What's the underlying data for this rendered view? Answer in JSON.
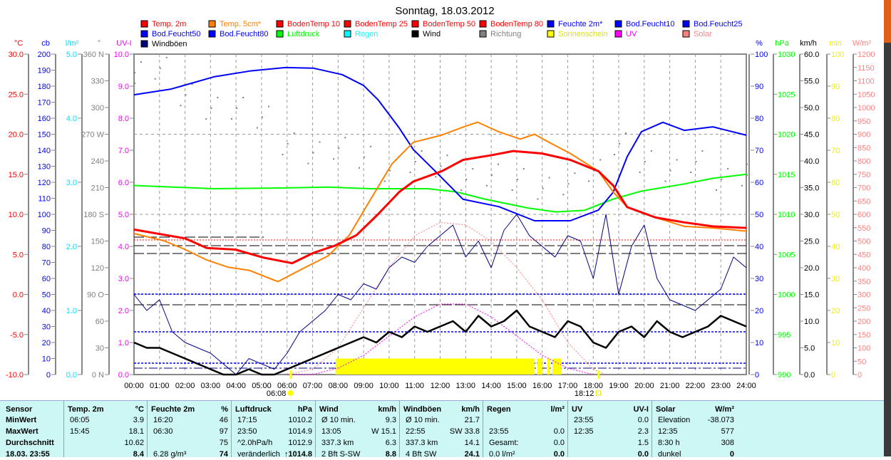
{
  "title": "Sonntag, 18.03.2012",
  "legend": [
    {
      "label": "Temp. 2m",
      "color": "#ff0000"
    },
    {
      "label": "Temp. 5cm*",
      "color": "#ff8000"
    },
    {
      "label": "BodenTemp 10",
      "color": "#ff0000"
    },
    {
      "label": "BodenTemp 25",
      "color": "#ff0000"
    },
    {
      "label": "BodenTemp 50",
      "color": "#ff0000"
    },
    {
      "label": "BodenTemp 80",
      "color": "#ff0000"
    },
    {
      "label": "Feuchte 2m*",
      "color": "#0000ff"
    },
    {
      "label": "Bod.Feucht10",
      "color": "#0000ff"
    },
    {
      "label": "Bod.Feucht25",
      "color": "#0000ff"
    },
    {
      "label": "Bod.Feucht50",
      "color": "#0000ff"
    },
    {
      "label": "Bod.Feucht80",
      "color": "#0000ff"
    },
    {
      "label": "Luftdruck",
      "color": "#00ff00"
    },
    {
      "label": "Regen",
      "color": "#00ffff"
    },
    {
      "label": "Wind",
      "color": "#000000"
    },
    {
      "label": "Richtung",
      "color": "#808080"
    },
    {
      "label": "Sonnenschein",
      "color": "#ffff00"
    },
    {
      "label": "UV",
      "color": "#ff00ff"
    },
    {
      "label": "Solar",
      "color": "#ff8080"
    },
    {
      "label": "Windböen",
      "color": "#000080"
    }
  ],
  "chart_data": {
    "type": "line",
    "title": "Sonntag, 18.03.2012",
    "x_ticks": [
      "00:00",
      "01:00",
      "02:00",
      "03:00",
      "04:00",
      "05:00",
      "06:00",
      "07:00",
      "08:00",
      "09:00",
      "10:00",
      "11:00",
      "12:00",
      "13:00",
      "14:00",
      "15:00",
      "16:00",
      "17:00",
      "18:00",
      "19:00",
      "20:00",
      "21:00",
      "22:00",
      "23:00",
      "24:00"
    ],
    "x_range_hours": [
      0,
      24
    ],
    "sunrise": {
      "label": "06:08",
      "hour": 6.13
    },
    "sunset": {
      "label": "18:12",
      "hour": 18.2
    },
    "grid": true,
    "left_axes": [
      {
        "key": "temp",
        "unit": "°C",
        "color": "#ff0000",
        "range": [
          -10,
          30
        ],
        "labels": [
          "30.0",
          "25.0",
          "20.0",
          "15.0",
          "10.0",
          "5.0",
          "0.0",
          "-5.0",
          "-10.0"
        ]
      },
      {
        "key": "cb",
        "unit": "cb",
        "color": "#0000ff",
        "range": [
          0,
          200
        ],
        "labels": [
          "200",
          "190",
          "180",
          "170",
          "160",
          "150",
          "140",
          "130",
          "120",
          "110",
          "100",
          "90",
          "80",
          "70",
          "60",
          "50",
          "40",
          "30",
          "20",
          "10",
          "0"
        ]
      },
      {
        "key": "rain",
        "unit": "l/m²",
        "color": "#00ffff",
        "range": [
          0,
          5
        ],
        "labels": [
          "5.0",
          "4.0",
          "3.0",
          "2.0",
          "1.0",
          "0.0"
        ]
      },
      {
        "key": "deg",
        "unit": "°",
        "color": "#808080",
        "range": [
          0,
          360
        ],
        "labels": [
          "360 N",
          "330",
          "300",
          "270 W",
          "240",
          "210",
          "180 S",
          "150",
          "120",
          "90 O",
          "60",
          "30",
          "0 N"
        ]
      },
      {
        "key": "uv",
        "unit": "UV-I",
        "color": "#ff00ff",
        "range": [
          0,
          10
        ],
        "labels": [
          "10.0",
          "9.0",
          "8.0",
          "7.0",
          "6.0",
          "5.0",
          "4.0",
          "3.0",
          "2.0",
          "1.0",
          "0.0"
        ]
      }
    ],
    "right_axes": [
      {
        "key": "pct",
        "unit": "%",
        "color": "#0000ff",
        "range": [
          0,
          100
        ],
        "labels": [
          "100",
          "90",
          "80",
          "70",
          "60",
          "50",
          "40",
          "30",
          "20",
          "10",
          "0"
        ]
      },
      {
        "key": "hpa",
        "unit": "hPa",
        "color": "#00ff00",
        "range": [
          990,
          1030
        ],
        "labels": [
          "1030",
          "1025",
          "1020",
          "1015",
          "1010",
          "1005",
          "1000",
          "995",
          "990"
        ]
      },
      {
        "key": "kmh",
        "unit": "km/h",
        "color": "#000000",
        "range": [
          0,
          60
        ],
        "labels": [
          "60.0",
          "55.0",
          "50.0",
          "45.0",
          "40.0",
          "35.0",
          "30.0",
          "25.0",
          "20.0",
          "15.0",
          "10.0",
          "5.0",
          "0.0"
        ]
      },
      {
        "key": "min",
        "unit": "min",
        "color": "#ffff00",
        "range": [
          0,
          100
        ],
        "labels": [
          "100",
          "90",
          "80",
          "70",
          "60",
          "50",
          "40",
          "30",
          "20",
          "10",
          "0"
        ]
      },
      {
        "key": "solar",
        "unit": "W/m²",
        "color": "#ff8080",
        "range": [
          0,
          1200
        ],
        "labels": [
          "1200",
          "1150",
          "1100",
          "1050",
          "1000",
          "950",
          "900",
          "850",
          "800",
          "750",
          "700",
          "650",
          "600",
          "550",
          "500",
          "450",
          "400",
          "350",
          "300",
          "250",
          "200",
          "150",
          "100",
          "50",
          "0"
        ]
      }
    ],
    "series": [
      {
        "name": "Luftdruck",
        "axis": "hpa",
        "color": "#00ff00",
        "width": 2,
        "points": [
          [
            0,
            1013.6
          ],
          [
            3.13,
            1013.2
          ],
          [
            5.92,
            1013.3
          ],
          [
            7.6,
            1013.4
          ],
          [
            9.28,
            1013.2
          ],
          [
            11.51,
            1013.2
          ],
          [
            12.63,
            1012.8
          ],
          [
            13.75,
            1011.9
          ],
          [
            15.42,
            1010.8
          ],
          [
            16.54,
            1010.3
          ],
          [
            17.65,
            1010.5
          ],
          [
            18.78,
            1011.9
          ],
          [
            19.89,
            1012.9
          ],
          [
            21.57,
            1013.8
          ],
          [
            22.69,
            1014.5
          ],
          [
            24,
            1015.0
          ]
        ]
      },
      {
        "name": "Feuchte 2m*",
        "axis": "pct",
        "color": "#0000ff",
        "width": 2,
        "points": [
          [
            0,
            87.3
          ],
          [
            1.45,
            89.1
          ],
          [
            3.13,
            92.9
          ],
          [
            4.53,
            94.7
          ],
          [
            5.92,
            95.8
          ],
          [
            7.04,
            95.6
          ],
          [
            8.16,
            93.6
          ],
          [
            9.0,
            90.2
          ],
          [
            9.56,
            85.8
          ],
          [
            10.4,
            76.9
          ],
          [
            10.95,
            70.2
          ],
          [
            11.79,
            63.6
          ],
          [
            12.9,
            54.7
          ],
          [
            14.3,
            52.4
          ],
          [
            15.7,
            48.0
          ],
          [
            17.1,
            48.0
          ],
          [
            18.2,
            51.3
          ],
          [
            18.78,
            56.9
          ],
          [
            19.33,
            68.0
          ],
          [
            19.89,
            75.8
          ],
          [
            20.73,
            78.7
          ],
          [
            21.57,
            76.2
          ],
          [
            22.69,
            77.3
          ],
          [
            24,
            74.7
          ]
        ]
      },
      {
        "name": "Temp. 5cm*",
        "axis": "temp",
        "color": "#ff8000",
        "width": 2,
        "points": [
          [
            0,
            7.6
          ],
          [
            1.17,
            6.7
          ],
          [
            2.01,
            5.6
          ],
          [
            2.85,
            4.3
          ],
          [
            3.69,
            3.4
          ],
          [
            4.53,
            3.0
          ],
          [
            5.64,
            1.6
          ],
          [
            6.48,
            3.0
          ],
          [
            7.6,
            4.8
          ],
          [
            8.44,
            7.4
          ],
          [
            9.28,
            11.9
          ],
          [
            10.11,
            16.3
          ],
          [
            10.95,
            19.0
          ],
          [
            12.07,
            19.9
          ],
          [
            12.9,
            20.9
          ],
          [
            13.47,
            21.5
          ],
          [
            14.3,
            20.3
          ],
          [
            15.14,
            19.4
          ],
          [
            15.7,
            20.0
          ],
          [
            16.26,
            19.0
          ],
          [
            17.1,
            17.6
          ],
          [
            18.2,
            15.4
          ],
          [
            18.78,
            12.8
          ],
          [
            19.33,
            10.9
          ],
          [
            20.45,
            9.6
          ],
          [
            21.57,
            8.5
          ],
          [
            22.69,
            8.3
          ],
          [
            24,
            7.9
          ]
        ]
      },
      {
        "name": "Temp. 2m",
        "axis": "temp",
        "color": "#ff0000",
        "width": 3,
        "points": [
          [
            0,
            8.1
          ],
          [
            2.0,
            7.0
          ],
          [
            2.85,
            5.8
          ],
          [
            3.97,
            5.6
          ],
          [
            5.08,
            4.6
          ],
          [
            6.2,
            3.9
          ],
          [
            7.04,
            5.2
          ],
          [
            7.88,
            6.1
          ],
          [
            8.72,
            7.4
          ],
          [
            9.56,
            10.0
          ],
          [
            10.4,
            12.8
          ],
          [
            10.95,
            14.1
          ],
          [
            12.07,
            15.4
          ],
          [
            12.9,
            16.8
          ],
          [
            14.03,
            17.4
          ],
          [
            14.86,
            17.9
          ],
          [
            15.98,
            17.6
          ],
          [
            17.1,
            16.8
          ],
          [
            18.2,
            15.4
          ],
          [
            18.78,
            13.6
          ],
          [
            19.33,
            10.9
          ],
          [
            20.45,
            9.6
          ],
          [
            21.57,
            9.0
          ],
          [
            22.69,
            8.5
          ],
          [
            24,
            8.3
          ]
        ]
      },
      {
        "name": "Solar",
        "axis": "solar",
        "color": "#ff8080",
        "width": 1,
        "dash": "2,2",
        "points": [
          [
            6,
            0
          ],
          [
            7,
            20
          ],
          [
            8,
            100
          ],
          [
            9,
            250
          ],
          [
            10,
            400
          ],
          [
            11,
            520
          ],
          [
            12,
            570
          ],
          [
            13,
            560
          ],
          [
            14,
            500
          ],
          [
            15,
            400
          ],
          [
            16,
            280
          ],
          [
            17,
            120
          ],
          [
            18,
            20
          ],
          [
            18.5,
            0
          ]
        ]
      },
      {
        "name": "UV",
        "axis": "uv",
        "color": "#ff00ff",
        "width": 1,
        "dash": "2,2",
        "points": [
          [
            6,
            0
          ],
          [
            7,
            0
          ],
          [
            8,
            0.2
          ],
          [
            9,
            0.6
          ],
          [
            10,
            1.2
          ],
          [
            11,
            1.8
          ],
          [
            12,
            2.2
          ],
          [
            13,
            2.2
          ],
          [
            14,
            1.8
          ],
          [
            15,
            1.2
          ],
          [
            16,
            0.6
          ],
          [
            17,
            0.2
          ],
          [
            18,
            0
          ]
        ]
      },
      {
        "name": "Windböen",
        "axis": "kmh",
        "color": "#000080",
        "width": 1,
        "start": 0,
        "step": 0.5,
        "values": [
          15,
          12,
          14,
          8,
          6,
          5,
          4,
          2,
          0,
          3,
          2,
          1,
          4,
          8,
          10,
          12,
          15,
          14,
          17,
          16,
          20,
          22,
          21,
          24,
          26,
          28,
          22,
          25,
          20,
          27,
          30,
          26,
          24,
          22,
          26,
          25,
          18,
          30,
          15,
          24,
          28,
          18,
          14,
          13,
          12,
          14,
          16,
          22,
          20
        ]
      },
      {
        "name": "Wind",
        "axis": "kmh",
        "color": "#000000",
        "width": 2.5,
        "start": 0,
        "step": 0.5,
        "values": [
          6,
          5,
          5,
          4,
          3,
          2,
          1,
          0,
          0,
          1,
          0,
          0,
          1,
          2,
          3,
          4,
          5,
          6,
          7,
          6,
          8,
          7,
          9,
          8,
          9,
          10,
          8,
          11,
          9,
          10,
          12,
          9,
          8,
          7,
          10,
          9,
          6,
          5,
          8,
          9,
          7,
          10,
          8,
          7,
          8,
          9,
          11,
          10,
          9
        ]
      }
    ],
    "direction": {
      "axis": "deg",
      "color": "#808080",
      "start": 0,
      "step": 1,
      "values": [
        340,
        345,
        315,
        300,
        300,
        290,
        260,
        250,
        255,
        245,
        230,
        240,
        235,
        220,
        225,
        220,
        210,
        215,
        230,
        260,
        240,
        230,
        240,
        220,
        225
      ]
    },
    "sunshine": {
      "axis": "min",
      "color": "#ffff00",
      "value": 5,
      "intervals": [
        [
          7.9,
          15.7
        ],
        [
          15.8,
          16.0
        ],
        [
          16.2,
          16.3
        ],
        [
          16.4,
          16.75
        ]
      ]
    }
  },
  "table": {
    "sensor_header": "Sensor",
    "row_labels": [
      "MinWert",
      "MaxWert",
      "Durchschnitt",
      "18.03. 23:55"
    ],
    "groups": [
      {
        "name": "Temp. 2m",
        "unit": "°C",
        "rows": [
          [
            "06:05",
            "3.9"
          ],
          [
            "15:45",
            "18.1"
          ],
          [
            "",
            "10.62"
          ],
          [
            "",
            "8.4"
          ]
        ]
      },
      {
        "name": "Feuchte 2m",
        "unit": "%",
        "rows": [
          [
            "16:20",
            "46"
          ],
          [
            "06:30",
            "97"
          ],
          [
            "",
            "75"
          ],
          [
            "6.28 g/m³",
            "74"
          ]
        ]
      },
      {
        "name": "Luftdruck",
        "unit": "hPa",
        "rows": [
          [
            "17:15",
            "1010.2"
          ],
          [
            "23:50",
            "1014.9"
          ],
          [
            "^2.0hPa/h",
            "1012.9"
          ],
          [
            "veränderlich",
            "↑1014.8"
          ]
        ]
      },
      {
        "name": "Wind",
        "unit": "km/h",
        "rows": [
          [
            "Ø 10 min.",
            "9.3"
          ],
          [
            "13:05",
            "W 15.1"
          ],
          [
            "337.3 km",
            "6.3"
          ],
          [
            "2 Bft S-SW",
            "8.8"
          ]
        ]
      },
      {
        "name": "Windböen",
        "unit": "km/h",
        "rows": [
          [
            "Ø 10 min.",
            "21.7"
          ],
          [
            "22:55",
            "SW 33.8"
          ],
          [
            "337.3 km",
            "14.1"
          ],
          [
            "4 Bft SW",
            "24.1"
          ]
        ]
      },
      {
        "name": "Regen",
        "unit": "l/m²",
        "rows": [
          [
            "",
            ""
          ],
          [
            "23:55",
            "0.0"
          ],
          [
            "Gesamt:",
            "0.0"
          ],
          [
            "0.0 l/m²",
            "0.0"
          ]
        ]
      },
      {
        "name": "UV",
        "unit": "UV-I",
        "rows": [
          [
            "23:55",
            "0.0"
          ],
          [
            "12:35",
            "2.3"
          ],
          [
            "",
            "1.5"
          ],
          [
            "",
            "0.0"
          ]
        ]
      },
      {
        "name": "Solar",
        "unit": "W/m²",
        "rows": [
          [
            "Elevation",
            "-38.073"
          ],
          [
            "12:35",
            "577"
          ],
          [
            "8:30 h",
            "308"
          ],
          [
            "dunkel",
            "0"
          ]
        ]
      }
    ]
  }
}
